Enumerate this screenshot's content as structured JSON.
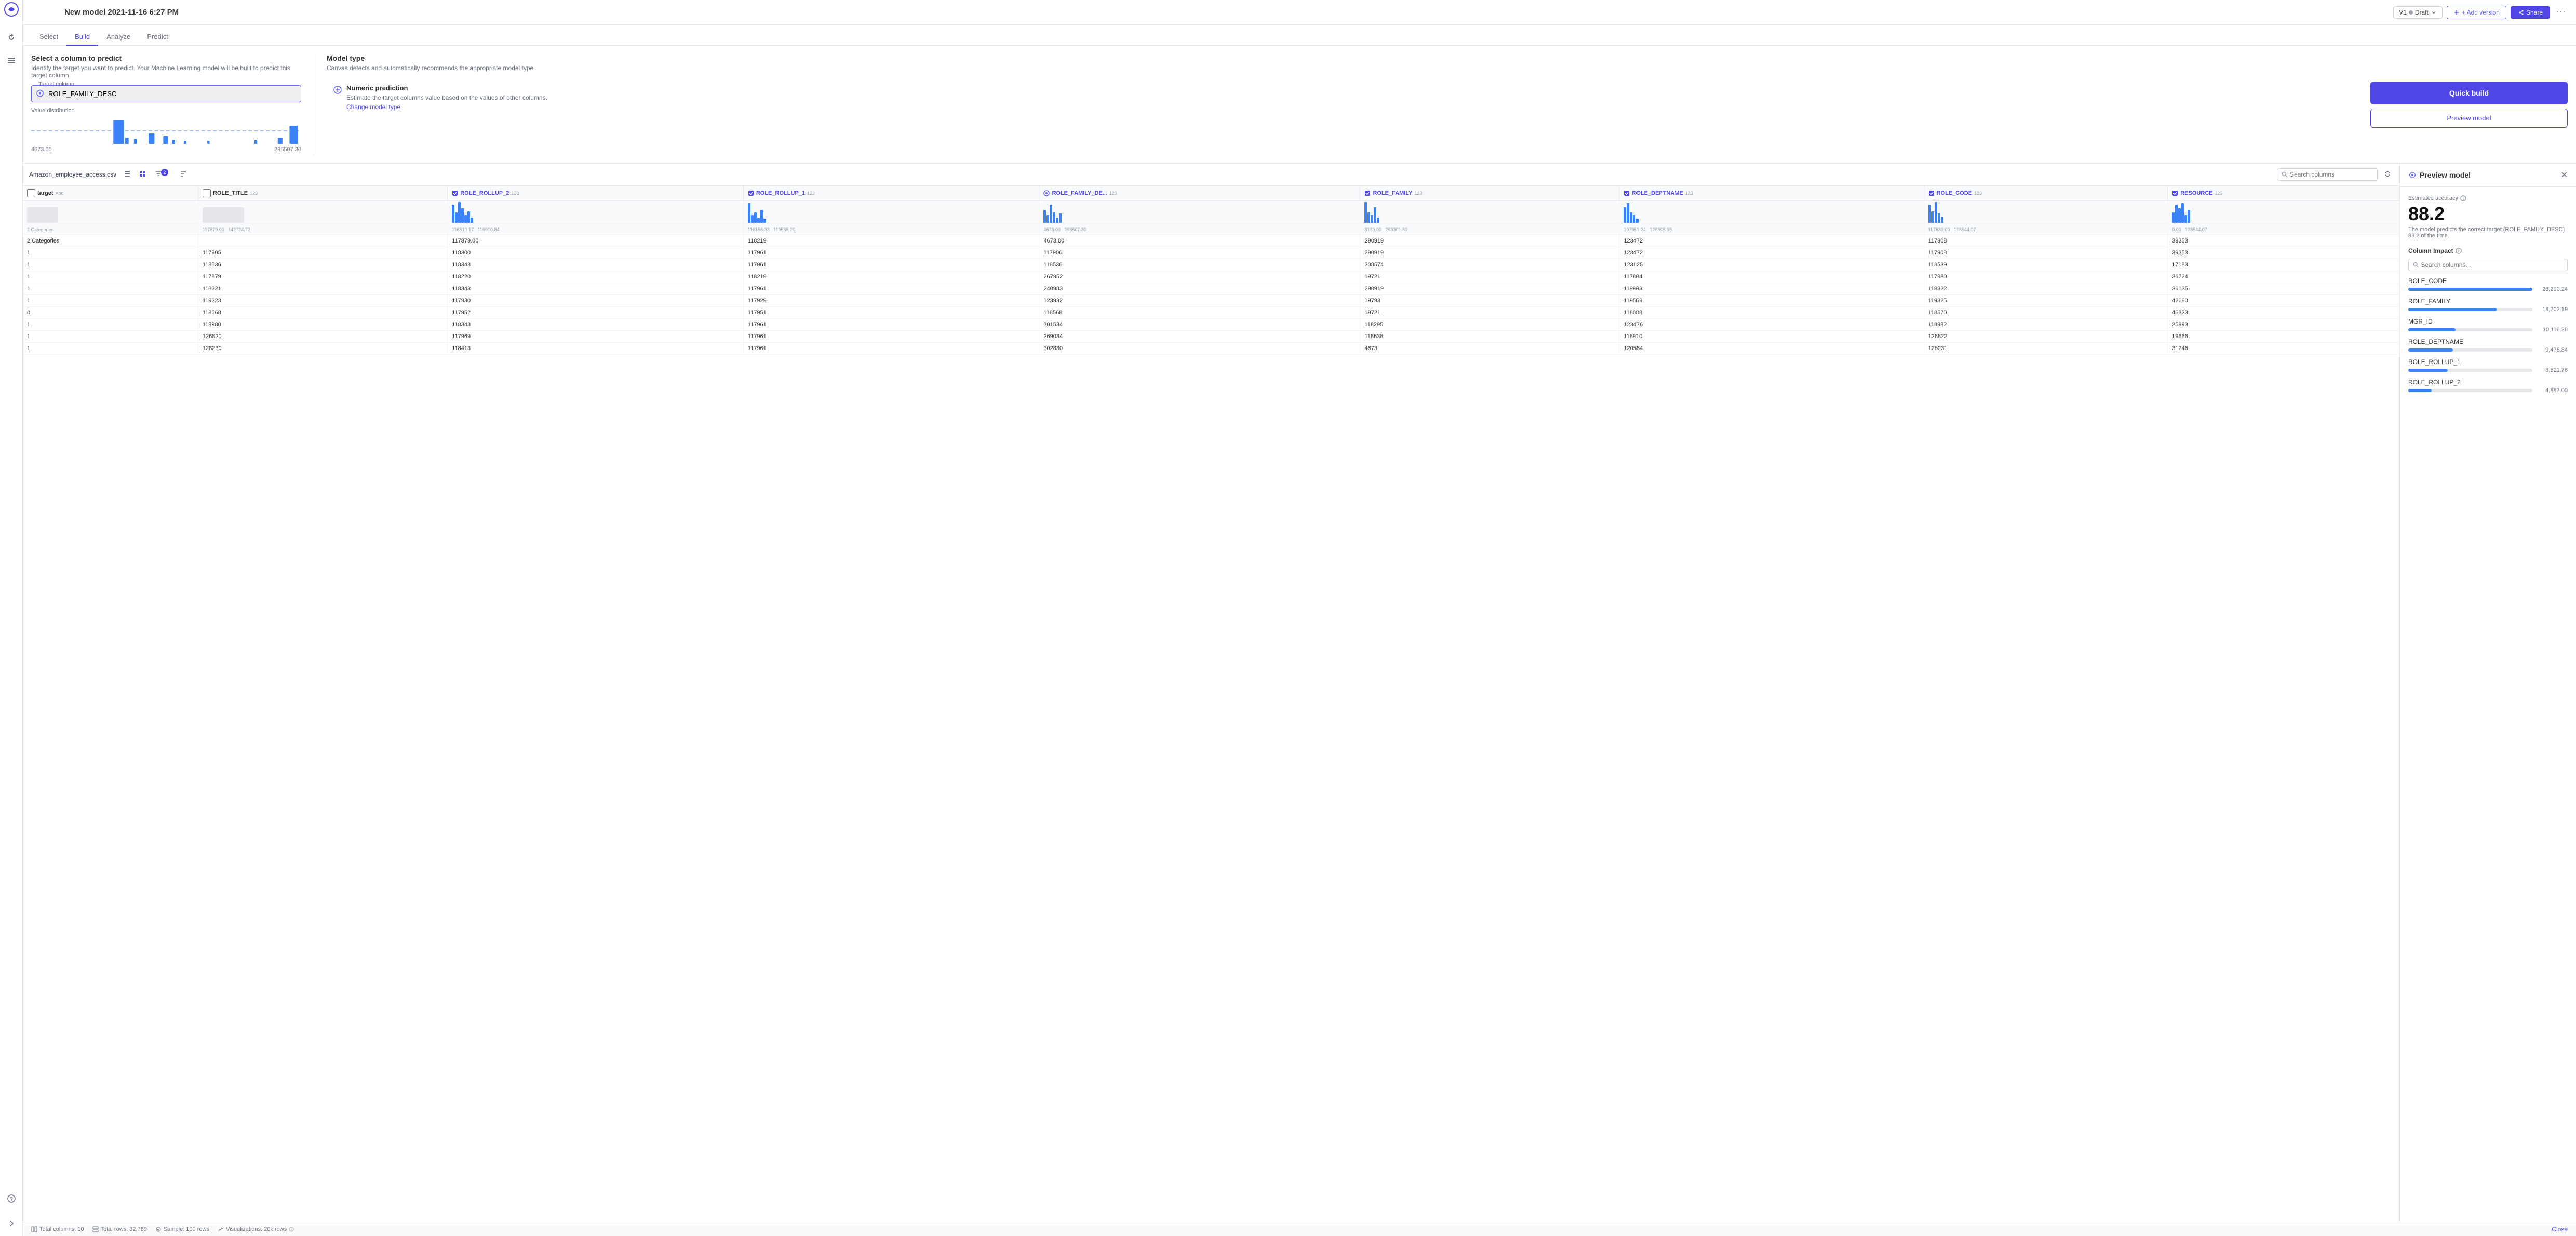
{
  "app": {
    "title": "New model 2021-11-16 6:27 PM"
  },
  "topbar": {
    "version": "V1",
    "status": "Draft",
    "add_version_label": "+ Add version",
    "share_label": "Share"
  },
  "tabs": [
    {
      "label": "Select",
      "active": false
    },
    {
      "label": "Build",
      "active": true
    },
    {
      "label": "Analyze",
      "active": false
    },
    {
      "label": "Predict",
      "active": false
    }
  ],
  "build": {
    "predict_title": "Select a column to predict",
    "predict_desc": "Identify the target you want to predict. Your Machine Learning model will be built to predict this target column.",
    "target_label": "Target column",
    "target_value": "ROLE_FAMILY_DESC",
    "value_dist_label": "Value distribution",
    "dist_range_min": "4673.00",
    "dist_range_max": "296507.30",
    "model_type_title": "Model type",
    "model_type_desc": "Canvas detects and automatically recommends the appropriate model type.",
    "model_type_name": "Numeric prediction",
    "model_type_detail": "Estimate the target columns value based on the values of other columns.",
    "change_model_label": "Change model type",
    "quick_build_label": "Quick build",
    "preview_model_label": "Preview model"
  },
  "table": {
    "file_name": "Amazon_employee_access.csv",
    "search_placeholder": "Search columns",
    "filter_badge": "2",
    "columns": [
      {
        "name": "target",
        "type": "Abc",
        "enabled": false,
        "is_target": true
      },
      {
        "name": "ROLE_TITLE",
        "type": "123",
        "enabled": false
      },
      {
        "name": "ROLE_ROLLUP_2",
        "type": "123",
        "enabled": true
      },
      {
        "name": "ROLE_ROLLUP_1",
        "type": "123",
        "enabled": true
      },
      {
        "name": "ROLE_FAMILY_DE...",
        "type": "123",
        "enabled": true,
        "is_target": true
      },
      {
        "name": "ROLE_FAMILY",
        "type": "123",
        "enabled": true
      },
      {
        "name": "ROLE_DEPTNAME",
        "type": "123",
        "enabled": true
      },
      {
        "name": "ROLE_CODE",
        "type": "123",
        "enabled": true
      },
      {
        "name": "RESOURCE",
        "type": "123",
        "enabled": true
      }
    ],
    "col_ranges": [
      {
        "min": "",
        "max": ""
      },
      {
        "min": "117879.00",
        "max": "142724.72"
      },
      {
        "min": "116510.17",
        "max": "119910.84"
      },
      {
        "min": "116156.33",
        "max": "119585.20"
      },
      {
        "min": "4673.00",
        "max": "296507.30"
      },
      {
        "min": "3130.00",
        "max": "293301.80"
      },
      {
        "min": "107851.24",
        "max": "128898.98"
      },
      {
        "min": "117880.00",
        "max": "128544.07"
      },
      {
        "min": "0.00",
        "max": "128544.07"
      }
    ],
    "rows": [
      {
        "target": "",
        "ROLE_TITLE": "",
        "ROLE_ROLLUP_2": "",
        "ROLE_ROLLUP_1": "",
        "ROLE_FAMILY_DE": "",
        "ROLE_FAMILY": "",
        "ROLE_DEPTNAME": "",
        "ROLE_CODE": "",
        "RESOURCE": ""
      },
      {
        "target": "2 Categories",
        "ROLE_TITLE": "",
        "ROLE_ROLLUP_2": "117879.00",
        "ROLE_ROLLUP_1": "118219",
        "ROLE_FAMILY_DE": "4673.00",
        "ROLE_FAMILY": "290919",
        "ROLE_DEPTNAME": "123472",
        "ROLE_CODE": "117908",
        "RESOURCE": "39353"
      },
      {
        "target": "1",
        "ROLE_TITLE": "117905",
        "ROLE_ROLLUP_2": "118300",
        "ROLE_ROLLUP_1": "117961",
        "ROLE_FAMILY_DE": "117906",
        "ROLE_FAMILY": "290919",
        "ROLE_DEPTNAME": "123472",
        "ROLE_CODE": "117908",
        "RESOURCE": "39353"
      },
      {
        "target": "1",
        "ROLE_TITLE": "118536",
        "ROLE_ROLLUP_2": "118343",
        "ROLE_ROLLUP_1": "117961",
        "ROLE_FAMILY_DE": "118536",
        "ROLE_FAMILY": "308574",
        "ROLE_DEPTNAME": "123125",
        "ROLE_CODE": "118539",
        "RESOURCE": "17183"
      },
      {
        "target": "1",
        "ROLE_TITLE": "117879",
        "ROLE_ROLLUP_2": "118220",
        "ROLE_ROLLUP_1": "118219",
        "ROLE_FAMILY_DE": "267952",
        "ROLE_FAMILY": "19721",
        "ROLE_DEPTNAME": "117884",
        "ROLE_CODE": "117880",
        "RESOURCE": "36724"
      },
      {
        "target": "1",
        "ROLE_TITLE": "118321",
        "ROLE_ROLLUP_2": "118343",
        "ROLE_ROLLUP_1": "117961",
        "ROLE_FAMILY_DE": "240983",
        "ROLE_FAMILY": "290919",
        "ROLE_DEPTNAME": "119993",
        "ROLE_CODE": "118322",
        "RESOURCE": "36135"
      },
      {
        "target": "1",
        "ROLE_TITLE": "119323",
        "ROLE_ROLLUP_2": "117930",
        "ROLE_ROLLUP_1": "117929",
        "ROLE_FAMILY_DE": "123932",
        "ROLE_FAMILY": "19793",
        "ROLE_DEPTNAME": "119569",
        "ROLE_CODE": "119325",
        "RESOURCE": "42680"
      },
      {
        "target": "0",
        "ROLE_TITLE": "118568",
        "ROLE_ROLLUP_2": "117952",
        "ROLE_ROLLUP_1": "117951",
        "ROLE_FAMILY_DE": "118568",
        "ROLE_FAMILY": "19721",
        "ROLE_DEPTNAME": "118008",
        "ROLE_CODE": "118570",
        "RESOURCE": "45333"
      },
      {
        "target": "1",
        "ROLE_TITLE": "118980",
        "ROLE_ROLLUP_2": "118343",
        "ROLE_ROLLUP_1": "117961",
        "ROLE_FAMILY_DE": "301534",
        "ROLE_FAMILY": "118295",
        "ROLE_DEPTNAME": "123476",
        "ROLE_CODE": "118982",
        "RESOURCE": "25993"
      },
      {
        "target": "1",
        "ROLE_TITLE": "126820",
        "ROLE_ROLLUP_2": "117969",
        "ROLE_ROLLUP_1": "117961",
        "ROLE_FAMILY_DE": "269034",
        "ROLE_FAMILY": "118638",
        "ROLE_DEPTNAME": "118910",
        "ROLE_CODE": "126822",
        "RESOURCE": "19666"
      },
      {
        "target": "1",
        "ROLE_TITLE": "128230",
        "ROLE_ROLLUP_2": "118413",
        "ROLE_ROLLUP_1": "117961",
        "ROLE_FAMILY_DE": "302830",
        "ROLE_FAMILY": "4673",
        "ROLE_DEPTNAME": "120584",
        "ROLE_CODE": "128231",
        "RESOURCE": "31246"
      }
    ]
  },
  "preview": {
    "title": "Preview model",
    "estimated_accuracy_label": "Estimated accuracy",
    "accuracy_value": "88.2",
    "accuracy_desc": "The model predicts the correct target (ROLE_FAMILY_DESC) 88.2 of the time.",
    "col_impact_label": "Column Impact",
    "search_placeholder": "Search columns...",
    "impact_items": [
      {
        "name": "ROLE_CODE",
        "value": 26290.24,
        "pct": 100
      },
      {
        "name": "ROLE_FAMILY",
        "value": 18702.19,
        "pct": 71
      },
      {
        "name": "MGR_ID",
        "value": 10116.28,
        "pct": 38
      },
      {
        "name": "ROLE_DEPTNAME",
        "value": 9478.84,
        "pct": 36
      },
      {
        "name": "ROLE_ROLLUP_1",
        "value": 8521.76,
        "pct": 32
      },
      {
        "name": "ROLE_ROLLUP_2",
        "value": 4887.0,
        "pct": 19
      }
    ]
  },
  "status_bar": {
    "total_columns": "Total columns: 10",
    "total_rows": "Total rows: 32,769",
    "sample": "Sample: 100 rows",
    "visualizations": "Visualizations: 20k rows",
    "close_label": "Close"
  }
}
